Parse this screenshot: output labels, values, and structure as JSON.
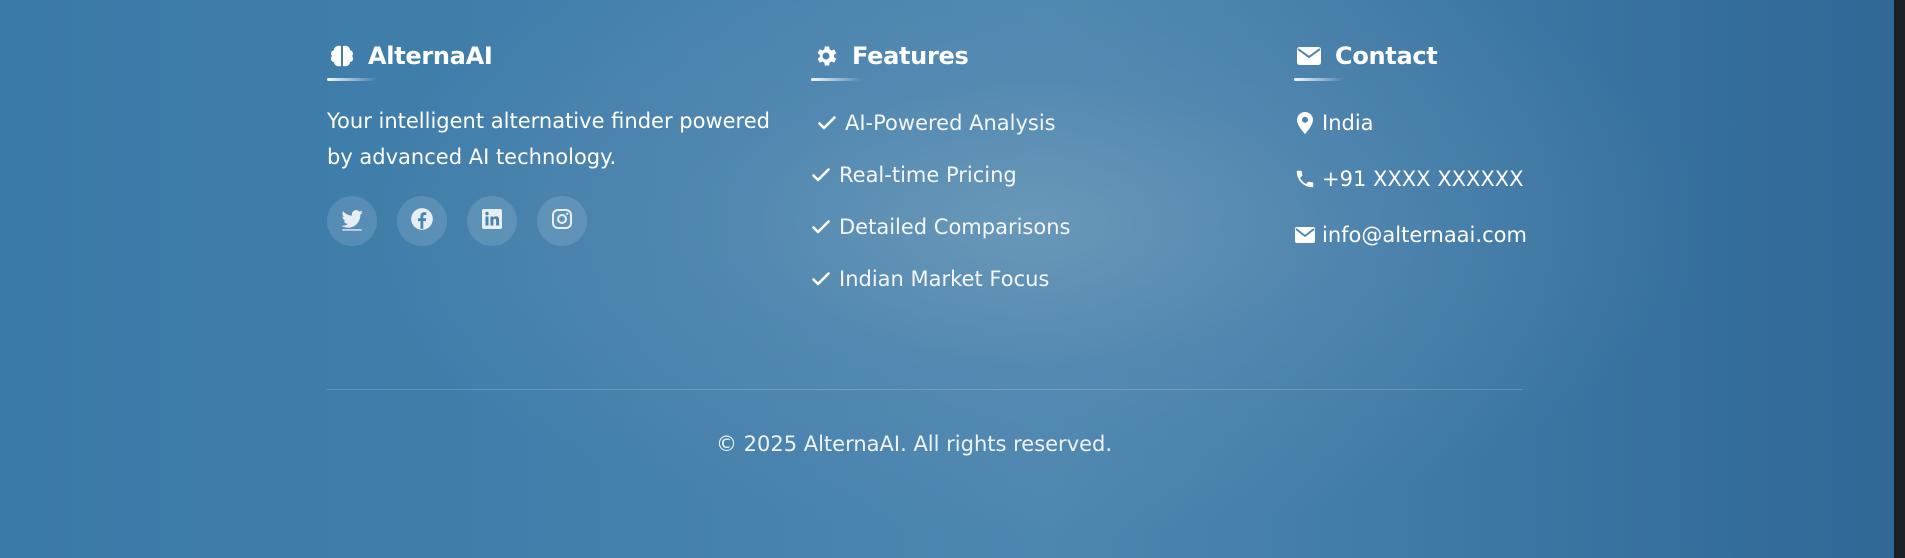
{
  "brand": {
    "name": "AlternaAI",
    "icon": "brain-icon",
    "tagline": "Your intelligent alternative finder powered by advanced AI technology.",
    "socials": [
      {
        "name": "twitter",
        "icon": "twitter-icon"
      },
      {
        "name": "facebook",
        "icon": "facebook-icon"
      },
      {
        "name": "linkedin",
        "icon": "linkedin-icon"
      },
      {
        "name": "instagram",
        "icon": "instagram-icon"
      }
    ]
  },
  "features": {
    "title": "Features",
    "icon": "gear-icon",
    "items": [
      "AI-Powered Analysis",
      "Real-time Pricing",
      "Detailed Comparisons",
      "Indian Market Focus"
    ]
  },
  "contact": {
    "title": "Contact",
    "icon": "envelope-icon",
    "location": "India",
    "phone": "+91 XXXX XXXXXX",
    "email": "info@alternaai.com"
  },
  "footer": {
    "copyright": "© 2025 AlternaAI. All rights reserved."
  },
  "colors": {
    "background_start": "#3a7aa8",
    "background_end": "#2f6795",
    "text": "#ffffff"
  }
}
